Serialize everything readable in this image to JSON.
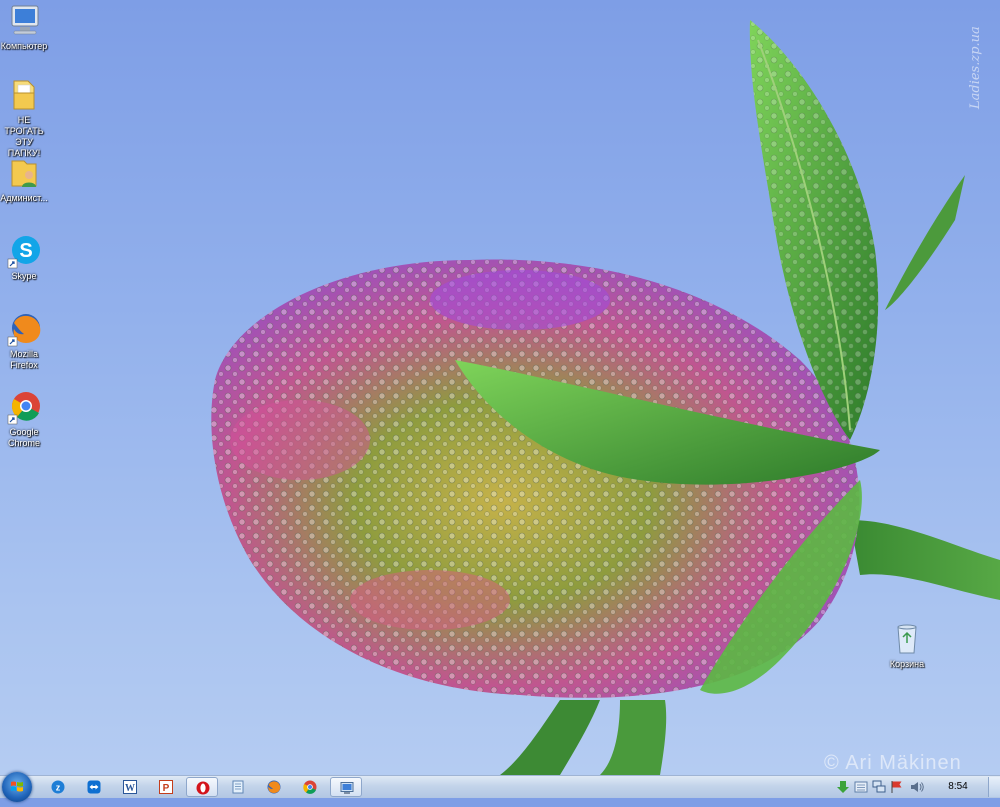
{
  "desktop": {
    "icons": [
      {
        "label": "Компьютер",
        "icon": "computer-icon"
      },
      {
        "label": "НЕ ТРОГАТЬ\nЭТУ ПАПКУ!",
        "icon": "folder-icon"
      },
      {
        "label": "Админист...",
        "icon": "user-folder-icon"
      },
      {
        "label": "Skype",
        "icon": "skype-icon"
      },
      {
        "label": "Mozilla\nFirefox",
        "icon": "firefox-icon"
      },
      {
        "label": "Google\nChrome",
        "icon": "chrome-icon"
      },
      {
        "label": "Корзина",
        "icon": "recycle-bin-icon"
      }
    ],
    "watermark_vertical": "Ladies.zp.ua",
    "watermark_bottom": "© Ari Mäkinen"
  },
  "taskbar": {
    "buttons": [
      {
        "icon": "zona-icon"
      },
      {
        "icon": "teamviewer-icon"
      },
      {
        "icon": "word-icon"
      },
      {
        "icon": "powerpoint-icon"
      },
      {
        "icon": "opera-icon",
        "active": true
      },
      {
        "icon": "notepad-icon"
      },
      {
        "icon": "firefox-icon"
      },
      {
        "icon": "chrome-icon"
      },
      {
        "icon": "remote-desktop-icon",
        "active": true
      }
    ],
    "tray_icons": [
      "download-arrow-icon",
      "keyboard-icon",
      "network-icon",
      "flag-icon",
      "volume-icon"
    ],
    "clock": "8:54"
  },
  "colors": {
    "sky": "#93b1ec",
    "taskbar": "#c3d4ea",
    "flower_pink": "#d24fa0",
    "flower_purple": "#9b3fd6",
    "leaf_green": "#3f9a36"
  }
}
